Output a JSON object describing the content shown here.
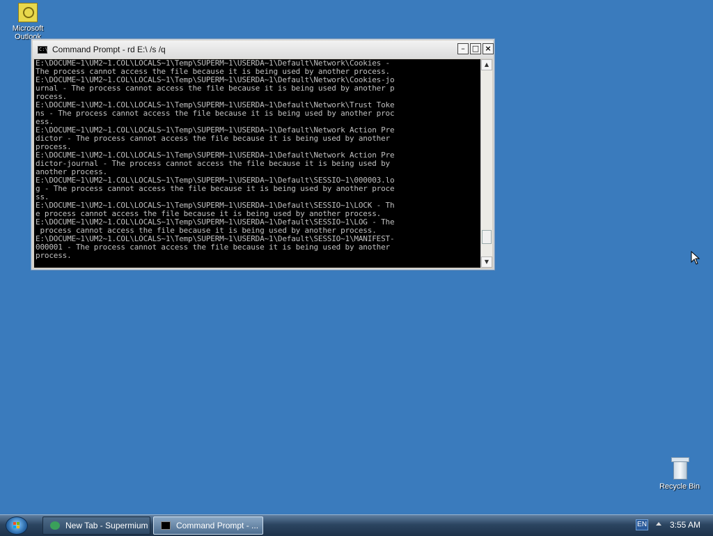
{
  "desktop": {
    "icons": [
      {
        "label": "Microsoft Outlook",
        "icon": "outlook-icon"
      },
      {
        "label": "Recycle Bin",
        "icon": "recycle-bin-icon"
      }
    ]
  },
  "window": {
    "title": "Command Prompt - rd E:\\ /s /q",
    "buttons": {
      "minimize": "–",
      "maximize": "□",
      "close": "×"
    },
    "console_lines": [
      "E:\\DOCUME~1\\UM2~1.COL\\LOCALS~1\\Temp\\SUPERM~1\\USERDA~1\\Default\\Network\\Cookies -",
      "The process cannot access the file because it is being used by another process.",
      "E:\\DOCUME~1\\UM2~1.COL\\LOCALS~1\\Temp\\SUPERM~1\\USERDA~1\\Default\\Network\\Cookies-jo",
      "urnal - The process cannot access the file because it is being used by another p",
      "rocess.",
      "E:\\DOCUME~1\\UM2~1.COL\\LOCALS~1\\Temp\\SUPERM~1\\USERDA~1\\Default\\Network\\Trust Toke",
      "ns - The process cannot access the file because it is being used by another proc",
      "ess.",
      "E:\\DOCUME~1\\UM2~1.COL\\LOCALS~1\\Temp\\SUPERM~1\\USERDA~1\\Default\\Network Action Pre",
      "dictor - The process cannot access the file because it is being used by another",
      "process.",
      "E:\\DOCUME~1\\UM2~1.COL\\LOCALS~1\\Temp\\SUPERM~1\\USERDA~1\\Default\\Network Action Pre",
      "dictor-journal - The process cannot access the file because it is being used by",
      "another process.",
      "E:\\DOCUME~1\\UM2~1.COL\\LOCALS~1\\Temp\\SUPERM~1\\USERDA~1\\Default\\SESSIO~1\\000003.lo",
      "g - The process cannot access the file because it is being used by another proce",
      "ss.",
      "E:\\DOCUME~1\\UM2~1.COL\\LOCALS~1\\Temp\\SUPERM~1\\USERDA~1\\Default\\SESSIO~1\\LOCK - Th",
      "e process cannot access the file because it is being used by another process.",
      "E:\\DOCUME~1\\UM2~1.COL\\LOCALS~1\\Temp\\SUPERM~1\\USERDA~1\\Default\\SESSIO~1\\LOG - The",
      " process cannot access the file because it is being used by another process.",
      "E:\\DOCUME~1\\UM2~1.COL\\LOCALS~1\\Temp\\SUPERM~1\\USERDA~1\\Default\\SESSIO~1\\MANIFEST-",
      "000001 - The process cannot access the file because it is being used by another",
      "process."
    ]
  },
  "taskbar": {
    "start_icon": "windows-start-icon",
    "tasks": [
      {
        "label": "New Tab - Supermium",
        "icon": "supermium-icon"
      },
      {
        "label": "Command Prompt - ...",
        "icon": "cmd-icon"
      }
    ],
    "language": "EN",
    "clock": "3:55 AM"
  }
}
